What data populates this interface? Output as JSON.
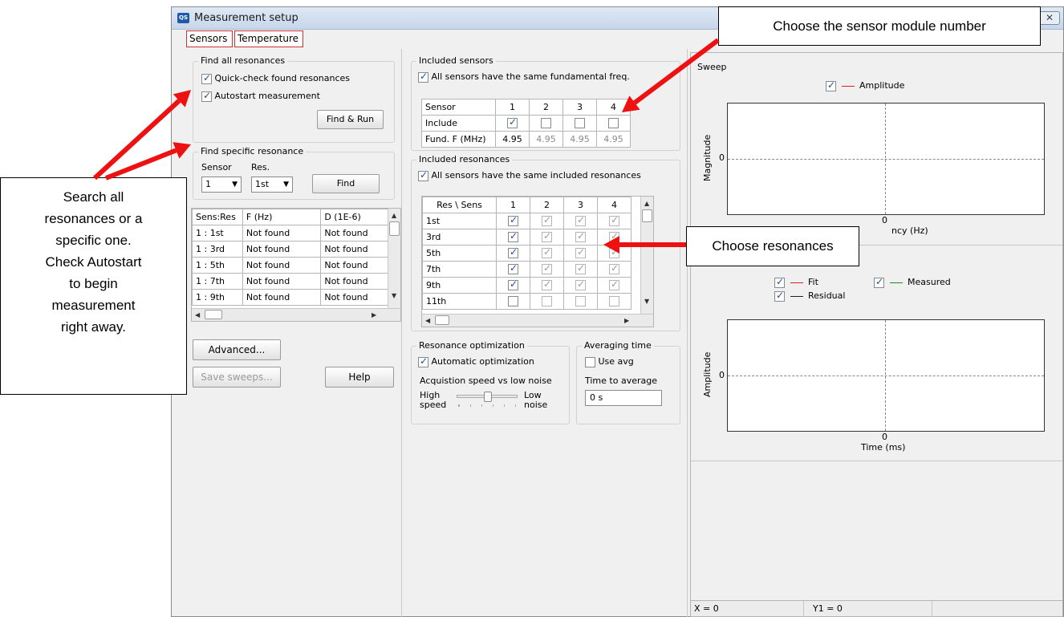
{
  "window": {
    "title": "Measurement setup",
    "app_icon": "QS",
    "close_label": "✕"
  },
  "tabs": [
    "Sensors",
    "Temperature"
  ],
  "find_all": {
    "title": "Find all resonances",
    "quick_check": "Quick-check found resonances",
    "autostart": "Autostart measurement",
    "button": "Find & Run"
  },
  "find_specific": {
    "title": "Find specific resonance",
    "sensor_label": "Sensor",
    "res_label": "Res.",
    "sensor_value": "1",
    "res_value": "1st",
    "button": "Find"
  },
  "results_table": {
    "headers": [
      "Sens:Res",
      "F (Hz)",
      "D (1E-6)"
    ],
    "rows": [
      [
        "1 : 1st",
        "Not found",
        "Not found"
      ],
      [
        "1 : 3rd",
        "Not found",
        "Not found"
      ],
      [
        "1 : 5th",
        "Not found",
        "Not found"
      ],
      [
        "1 : 7th",
        "Not found",
        "Not found"
      ],
      [
        "1 : 9th",
        "Not found",
        "Not found"
      ]
    ]
  },
  "buttons": {
    "advanced": "Advanced...",
    "save_sweeps": "Save sweeps...",
    "help": "Help"
  },
  "included_sensors": {
    "title": "Included sensors",
    "same_freq": "All sensors have the same fundamental freq.",
    "header": [
      "Sensor",
      "1",
      "2",
      "3",
      "4"
    ],
    "include_label": "Include",
    "fund_label": "Fund. F (MHz)",
    "fund_values": [
      "4.95",
      "4.95",
      "4.95",
      "4.95"
    ]
  },
  "included_resonances": {
    "title": "Included resonances",
    "same_res": "All sensors have the same included resonances",
    "header": [
      "Res \\ Sens",
      "1",
      "2",
      "3",
      "4"
    ],
    "rows": [
      "1st",
      "3rd",
      "5th",
      "7th",
      "9th",
      "11th"
    ]
  },
  "optimization": {
    "title": "Resonance optimization",
    "automatic": "Automatic optimization",
    "speed_label": "Acquistion speed vs low noise",
    "high": "High",
    "speed": "speed",
    "low": "Low",
    "noise": "noise"
  },
  "averaging": {
    "title": "Averaging time",
    "use_avg": "Use avg",
    "time_label": "Time to average",
    "time_value": "0 s"
  },
  "sweep_chart": {
    "title": "Sweep",
    "legend": "Amplitude",
    "ylabel": "Magnitude",
    "xlabel": "ncy (Hz)",
    "ytick": "0",
    "xtick": "0"
  },
  "time_chart": {
    "legend_fit": "Fit",
    "legend_measured": "Measured",
    "legend_residual": "Residual",
    "ylabel": "Amplitude",
    "xlabel": "Time (ms)",
    "ytick": "0",
    "xtick": "0"
  },
  "status": {
    "x": "X = 0",
    "y1": "Y1 = 0"
  },
  "callouts": {
    "sensor_module": "Choose the sensor module number",
    "resonances": "Choose resonances",
    "search_lines": [
      "Search all",
      "resonances or a",
      "specific one.",
      "Check Autostart",
      "to begin",
      "measurement",
      "right away."
    ]
  },
  "colors": {
    "arrow": "#ee1111",
    "fit_line": "#d62020",
    "measured_line": "#208a20",
    "residual_line": "#222222",
    "amplitude_line": "#d62020"
  }
}
